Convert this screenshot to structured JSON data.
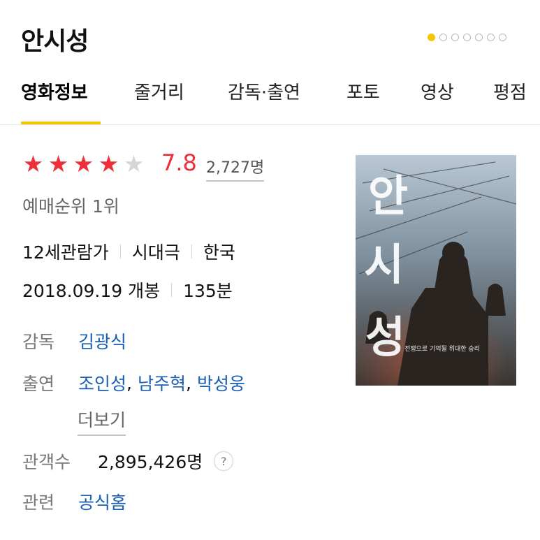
{
  "movie": {
    "title": "안시성",
    "tabs": [
      "영화정보",
      "줄거리",
      "감독·출연",
      "포토",
      "영상",
      "평점"
    ],
    "rating": {
      "stars_filled": 4,
      "stars_total": 5,
      "score": "7.8",
      "count": "2,727명"
    },
    "rank": "예매순위 1위",
    "meta_line1": [
      "12세관람가",
      "시대극",
      "한국"
    ],
    "meta_line2": [
      "2018.09.19 개봉",
      "135분"
    ],
    "director": {
      "label": "감독",
      "name": "김광식"
    },
    "cast": {
      "label": "출연",
      "names": [
        "조인성",
        "남주혁",
        "박성웅"
      ],
      "more": "더보기"
    },
    "audience": {
      "label": "관객수",
      "value": "2,895,426명",
      "help": "?"
    },
    "related": {
      "label": "관련",
      "link": "공식홈"
    },
    "poster": {
      "title_glyphs": [
        "안",
        "시",
        "성"
      ],
      "tagline": "전쟁으로 기억될 위대한 승리"
    }
  },
  "pager": {
    "count": 7,
    "active": 0
  },
  "colors": {
    "accent_yellow": "#f2c600",
    "star_red": "#ee2f3a",
    "link_blue": "#1a5fb4"
  }
}
